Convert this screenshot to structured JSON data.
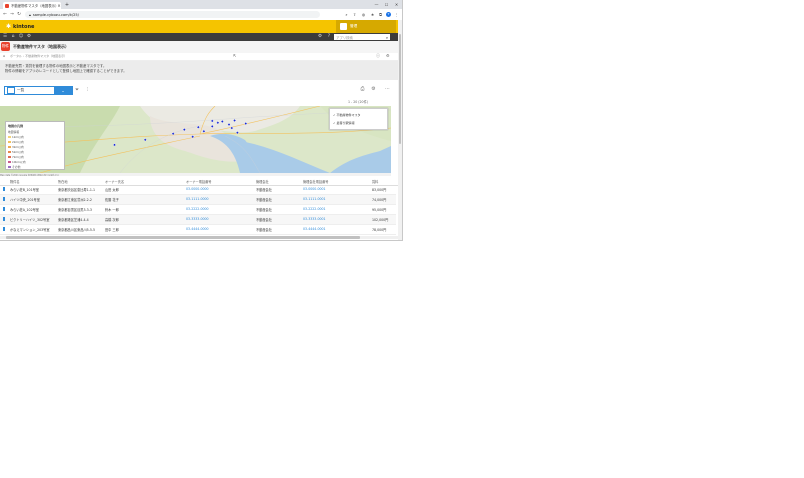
{
  "browser": {
    "tab_title": "不動産物件マスタ（地図表示）",
    "new_tab": "+",
    "url": "sample.cybozu.com/k/25/",
    "controls": {
      "minimize": "—",
      "maximize": "☐",
      "close": "✕"
    },
    "profile_initial": "T"
  },
  "kintone": {
    "logo": "kintone",
    "user_name": "管理",
    "search_placeholder": "アプリ検索",
    "app_icon": "物件",
    "app_title": "不動産物件マスタ（地図表示）",
    "breadcrumb": "ポータル › 不動産物件マスタ（地図表示）",
    "description": [
      "不動産売買・賃貸を管理する物件の地図表示と不動産マスタです。",
      "物件の情報をアプリのレコードとして登録し地図上で確認することができます。"
    ]
  },
  "view": {
    "selected": "一覧",
    "record_count": "1 - 20 (20件)"
  },
  "map": {
    "legend_title": "地図の凡例",
    "legend_sub": "地図情報",
    "legend_items": [
      {
        "label": "1km以内",
        "color": "#f3d37a"
      },
      {
        "label": "2km以内",
        "color": "#f3c25e"
      },
      {
        "label": "3km以内",
        "color": "#eeaa52"
      },
      {
        "label": "5km以内",
        "color": "#e8894a"
      },
      {
        "label": "7km以内",
        "color": "#e06b52"
      },
      {
        "label": "10km以内",
        "color": "#cc5a8c"
      },
      {
        "label": "その他",
        "color": "#9a6bc2"
      }
    ],
    "layers": [
      "不動産物件マスタ",
      "最寄り駅情報"
    ],
    "attribution": "Map data ©2021 Google  利用規約  地図の誤りを報告する"
  },
  "table": {
    "headers": [
      "物件名",
      "所在地",
      "オーナー氏名",
      "オーナー電話番号",
      "管理会社",
      "管理会社電話番号",
      "賃料"
    ],
    "rows": [
      [
        "みらい荘B_101号室",
        "東京都渋谷区恵比寿1-1-1",
        "山田 太郎",
        "03-0000-0000",
        "不動産会社",
        "03-0000-0001",
        "83,000円"
      ],
      [
        "ハイツ中央_201号室",
        "東京都江東区豊洲2-2-2",
        "佐藤 花子",
        "03-1111-0000",
        "不動産会社",
        "03-1111-0001",
        "74,000円"
      ],
      [
        "みらい荘A_102号室",
        "東京都目黒区目黒3-3-3",
        "鈴木 一郎",
        "03-2222-0000",
        "不動産会社",
        "03-2222-0001",
        "95,000円"
      ],
      [
        "ビクトリーハイツ_302号室",
        "東京都港区芝浦4-4-4",
        "高橋 次郎",
        "03-3333-0000",
        "不動産会社",
        "03-3333-0001",
        "102,000円"
      ],
      [
        "かなえマンション_203号室",
        "東京都品川区東品川5-5-5",
        "田中 三郎",
        "03-4444-0000",
        "不動産会社",
        "03-4444-0001",
        "78,000円"
      ]
    ]
  },
  "markers": [
    {
      "lat": 35.703,
      "lng": 139.76
    },
    {
      "lat": 35.7,
      "lng": 139.778
    },
    {
      "lat": 35.694,
      "lng": 139.77
    },
    {
      "lat": 35.685,
      "lng": 139.79
    },
    {
      "lat": 35.676,
      "lng": 139.76
    },
    {
      "lat": 35.672,
      "lng": 139.735
    },
    {
      "lat": 35.668,
      "lng": 139.795
    },
    {
      "lat": 35.66,
      "lng": 139.71
    },
    {
      "lat": 35.652,
      "lng": 139.745
    },
    {
      "lat": 35.645,
      "lng": 139.805
    },
    {
      "lat": 35.64,
      "lng": 139.69
    },
    {
      "lat": 35.625,
      "lng": 139.725
    },
    {
      "lat": 35.61,
      "lng": 139.64
    },
    {
      "lat": 35.585,
      "lng": 139.585
    },
    {
      "lat": 35.56,
      "lng": 139.48
    },
    {
      "lat": 35.548,
      "lng": 139.47
    },
    {
      "lat": 35.69,
      "lng": 139.82
    },
    {
      "lat": 35.705,
      "lng": 139.8
    }
  ]
}
